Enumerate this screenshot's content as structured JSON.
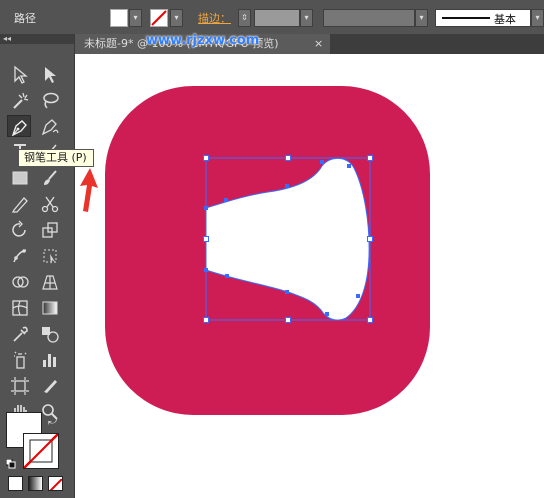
{
  "control_bar": {
    "object_type": "路径",
    "stroke_label": "描边：",
    "stroke_profile": "基本"
  },
  "document_tab": {
    "title": "未标题-9* @ 100% (CMYK/GPU 预览)",
    "close_glyph": "×"
  },
  "tools_panel": {
    "collapse_glyph": "◂◂",
    "active_tool": "pen-tool"
  },
  "tooltip": {
    "text": "钢笔工具 (P)"
  },
  "watermark": {
    "text": "www.rjzxw.com"
  },
  "colors": {
    "artboard_shape": "#cd1d54",
    "selection": "#3a6bff",
    "ui_panel": "#535353",
    "annotation_arrow": "#e8322a"
  }
}
